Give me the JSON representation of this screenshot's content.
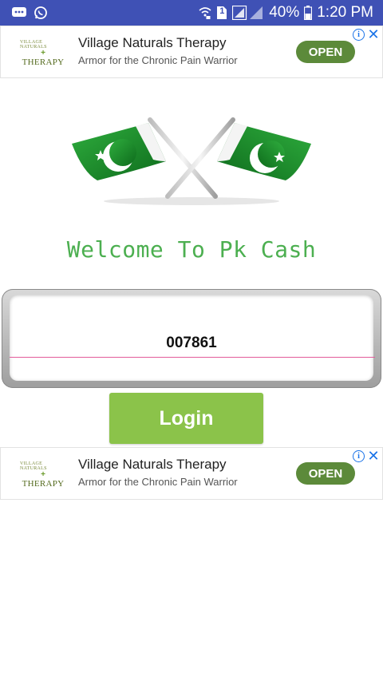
{
  "status_bar": {
    "battery": "40%",
    "time": "1:20 PM",
    "sim_badge": "1",
    "colors": {
      "background": "#3f51b5"
    },
    "icons": [
      "messages-icon",
      "whatsapp-icon",
      "wifi-calling-icon",
      "sim-icon",
      "signal-icon",
      "battery-icon"
    ]
  },
  "ads": [
    {
      "logo_top": "VILLAGE NATURALS",
      "logo_main": "THERAPY",
      "title": "Village Naturals Therapy",
      "subtitle": "Armor for the Chronic Pain Warrior",
      "button": "OPEN",
      "info_symbol": "i",
      "close_symbol": "✕"
    },
    {
      "logo_top": "VILLAGE NATURALS",
      "logo_main": "THERAPY",
      "title": "Village Naturals Therapy",
      "subtitle": "Armor for the Chronic Pain Warrior",
      "button": "OPEN",
      "info_symbol": "i",
      "close_symbol": "✕"
    }
  ],
  "main": {
    "welcome_text": "Welcome To Pk Cash",
    "input_value": "007861",
    "login_label": "Login",
    "colors": {
      "welcome": "#4caf50",
      "login_button": "#8bc34a",
      "flag_green": "#1b8a2b",
      "input_underline": "#e35b9a"
    }
  }
}
